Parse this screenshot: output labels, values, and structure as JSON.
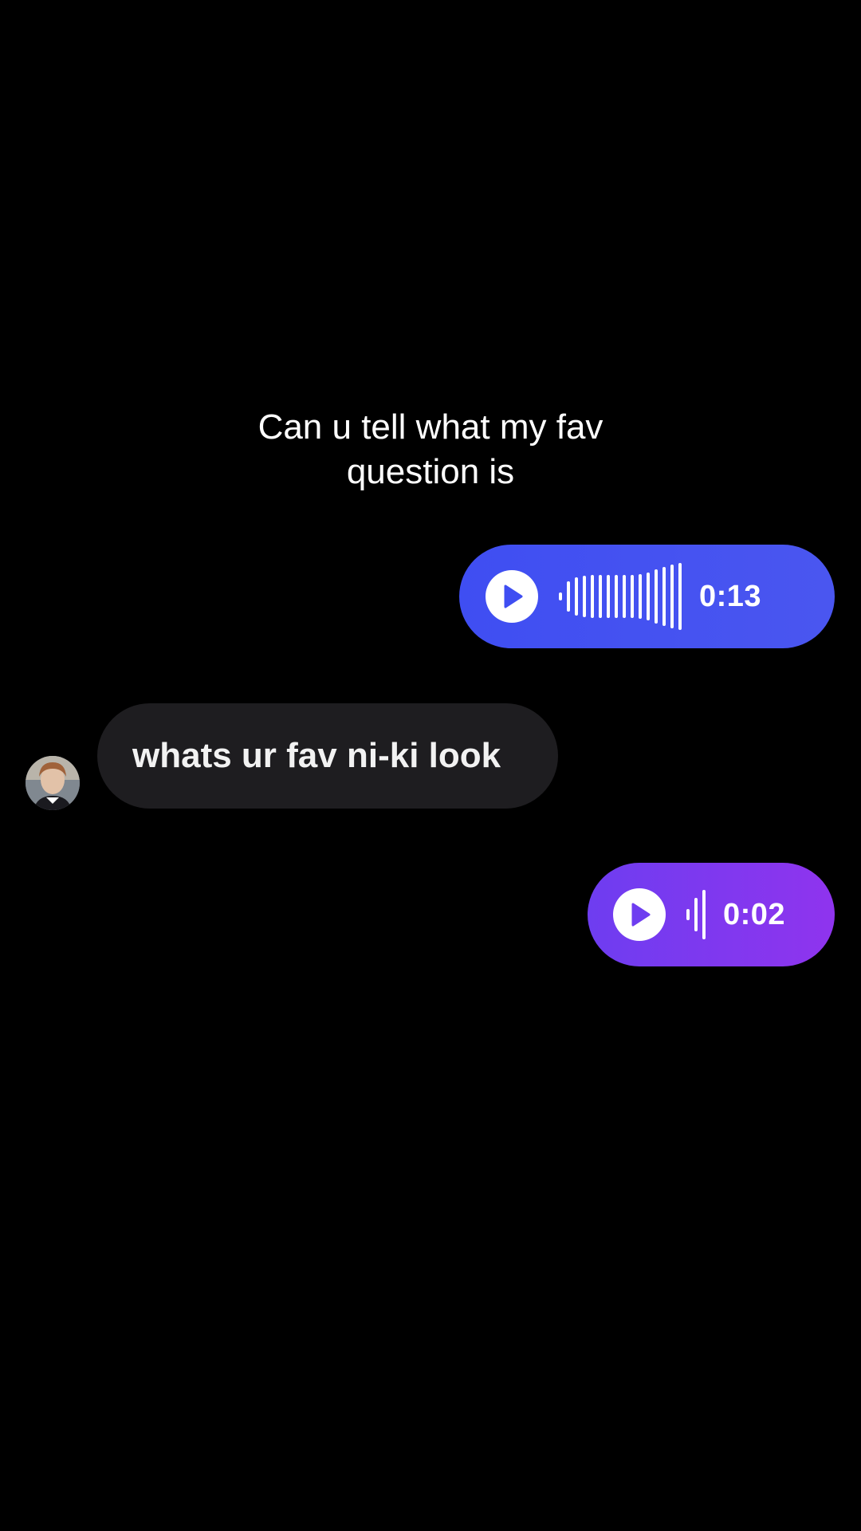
{
  "caption": {
    "line1": "Can u tell what my fav",
    "line2": "question is"
  },
  "messages": [
    {
      "type": "voice",
      "direction": "outgoing",
      "duration": "0:13",
      "play_icon": "play-icon",
      "color_start": "#3f4ef2",
      "color_end": "#4a56f0"
    },
    {
      "type": "text",
      "direction": "incoming",
      "text": "whats ur fav ni-ki look",
      "avatar": "sender-avatar"
    },
    {
      "type": "voice",
      "direction": "outgoing",
      "duration": "0:02",
      "play_icon": "play-icon",
      "color_start": "#6e3df0",
      "color_end": "#8f34ee"
    }
  ],
  "colors": {
    "background": "#000000",
    "incoming_bubble": "#1e1d20",
    "text": "#ffffff"
  }
}
